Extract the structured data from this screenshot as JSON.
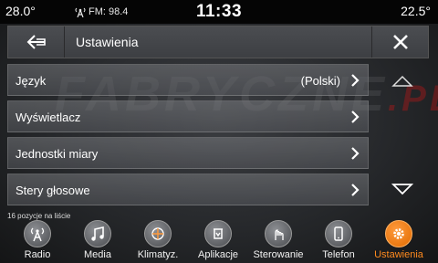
{
  "status": {
    "temp_left": "28.0°",
    "radio": "FM: 98.4",
    "clock": "11:33",
    "temp_right": "22.5°"
  },
  "header": {
    "title": "Ustawienia",
    "back_icon": "arrow-left-icon",
    "close_icon": "close-icon"
  },
  "watermark": {
    "text": "FABRYCZNE",
    "suffix": ".PL"
  },
  "list": {
    "items": [
      {
        "label": "Język",
        "value": "(Polski)"
      },
      {
        "label": "Wyświetlacz",
        "value": ""
      },
      {
        "label": "Jednostki miary",
        "value": ""
      },
      {
        "label": "Stery głosowe",
        "value": ""
      }
    ],
    "count_text": "16 pozycje na liście"
  },
  "nav": {
    "items": [
      {
        "label": "Radio",
        "icon": "radio-antenna-icon"
      },
      {
        "label": "Media",
        "icon": "music-note-icon"
      },
      {
        "label": "Klimatyz.",
        "icon": "climate-icon"
      },
      {
        "label": "Aplikacje",
        "icon": "apps-icon"
      },
      {
        "label": "Sterowanie",
        "icon": "controls-icon"
      },
      {
        "label": "Telefon",
        "icon": "phone-icon"
      },
      {
        "label": "Ustawienia",
        "icon": "gear-icon"
      }
    ],
    "active_color": "#ff8a1e"
  }
}
